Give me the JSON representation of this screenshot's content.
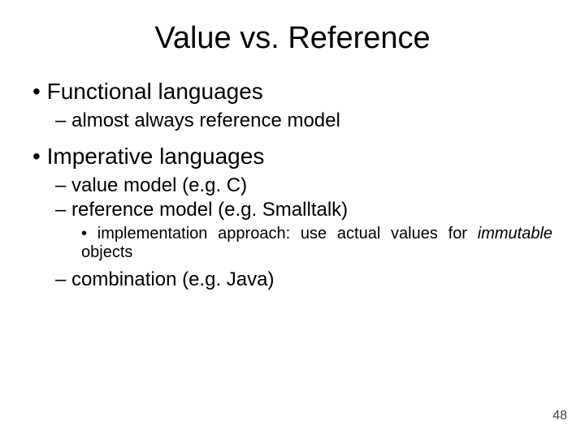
{
  "title": "Value vs. Reference",
  "b1": "Functional languages",
  "b1_1": "almost always reference model",
  "b2": "Imperative languages",
  "b2_1": "value model (e.g. C)",
  "b2_2": "reference model (e.g. Smalltalk)",
  "b2_2_1a": "implementation approach: use actual values for ",
  "b2_2_1b": "immutable",
  "b2_2_1c": " objects",
  "b2_3": "combination (e.g. Java)",
  "page": "48"
}
